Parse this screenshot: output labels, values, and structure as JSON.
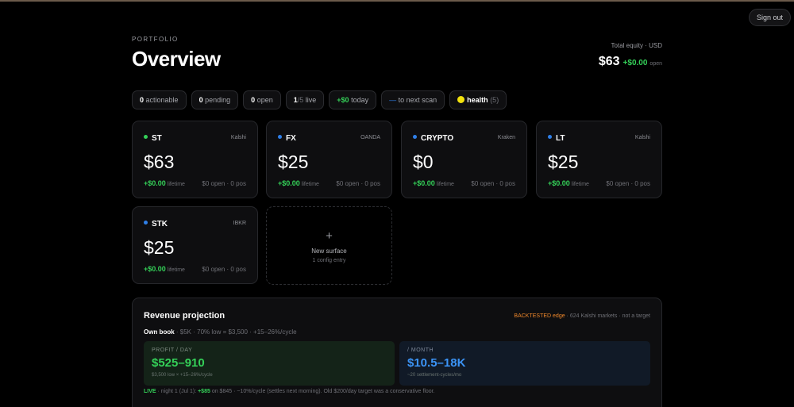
{
  "header": {
    "sign_out": "Sign out",
    "eyebrow": "PORTFOLIO",
    "title": "Overview",
    "equity_label": "Total equity · USD",
    "equity_value": "$63",
    "equity_pnl": "+$0.00",
    "equity_open": "open"
  },
  "chips": [
    {
      "num": "0",
      "label": "actionable"
    },
    {
      "num": "0",
      "label": "pending"
    },
    {
      "num": "0",
      "label": "open"
    },
    {
      "num": "1",
      "sub": "/5",
      "label": "live"
    },
    {
      "num": "+$0",
      "label": "today"
    },
    {
      "num": "—",
      "label": "to next scan"
    },
    {
      "num": "health",
      "sub": "(5)"
    }
  ],
  "cards": [
    {
      "name": "ST",
      "venue": "Kalshi",
      "balance": "$63",
      "pnl": "+$0.00",
      "lifetime": "lifetime",
      "stats": "$0 open · 0 pos",
      "dot": "#34d058"
    },
    {
      "name": "FX",
      "venue": "OANDA",
      "balance": "$25",
      "pnl": "+$0.00",
      "lifetime": "lifetime",
      "stats": "$0 open · 0 pos",
      "dot": "#2f7fe8"
    },
    {
      "name": "CRYPTO",
      "venue": "Kraken",
      "balance": "$0",
      "pnl": "+$0.00",
      "lifetime": "lifetime",
      "stats": "$0 open · 0 pos",
      "dot": "#2f7fe8"
    },
    {
      "name": "LT",
      "venue": "Kalshi",
      "balance": "$25",
      "pnl": "+$0.00",
      "lifetime": "lifetime",
      "stats": "$0 open · 0 pos",
      "dot": "#2f7fe8"
    },
    {
      "name": "STK",
      "venue": "IBKR",
      "balance": "$25",
      "pnl": "+$0.00",
      "lifetime": "lifetime",
      "stats": "$0 open · 0 pos",
      "dot": "#2f7fe8"
    }
  ],
  "new_surface": {
    "plus": "+",
    "label": "New surface",
    "sub": "1 config entry"
  },
  "revenue": {
    "title": "Revenue projection",
    "backtested": "BACKTESTED edge",
    "backtested_note": " · 624 Kalshi markets · not a target",
    "own_book": "Own book",
    "own_book_note": " · $5K · 70% low = $3,500 · +15–26%/cycle",
    "profit_label": "PROFIT / DAY",
    "profit_value": "$525–910",
    "profit_sub": "$3,500 low × +15–26%/cycle",
    "month_label": "/ MONTH",
    "month_value": "$10.5–18K",
    "month_sub": "~20 settlement-cycles/mo",
    "live_label": "LIVE",
    "live_pre": " · night 1 (Jul 1): ",
    "live_amt": "+$85",
    "live_post": " on $845 · ~10%/cycle (settles next morning). Old $200/day target was a conservative floor."
  }
}
